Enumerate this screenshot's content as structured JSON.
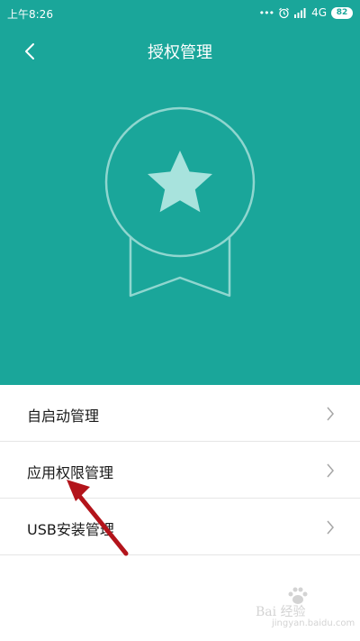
{
  "status_bar": {
    "time": "上午8:26",
    "dots": "•••",
    "network": "4G",
    "battery": "82"
  },
  "header": {
    "title": "授权管理",
    "background_color": "#1aa69a",
    "graphic": "badge-star-ribbon"
  },
  "menu": {
    "items": [
      {
        "label": "自启动管理"
      },
      {
        "label": "应用权限管理"
      },
      {
        "label": "USB安装管理"
      }
    ]
  },
  "annotation": {
    "type": "arrow",
    "color": "#b3141b",
    "points_to": "应用权限管理"
  },
  "watermark": {
    "brand": "Bai 经验",
    "url": "jingyan.baidu.com"
  }
}
